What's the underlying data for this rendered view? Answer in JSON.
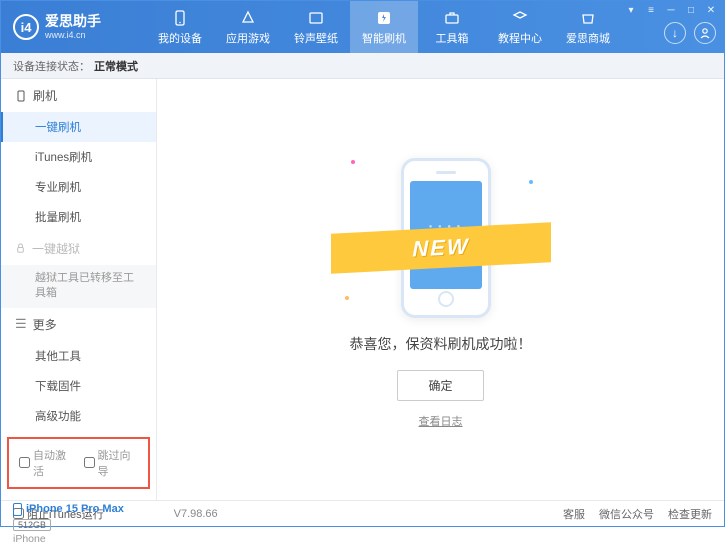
{
  "header": {
    "logo_title": "爱思助手",
    "logo_url": "www.i4.cn",
    "nav": [
      {
        "label": "我的设备"
      },
      {
        "label": "应用游戏"
      },
      {
        "label": "铃声壁纸"
      },
      {
        "label": "智能刷机"
      },
      {
        "label": "工具箱"
      },
      {
        "label": "教程中心"
      },
      {
        "label": "爱思商城"
      }
    ],
    "active_nav_index": 3
  },
  "status": {
    "label": "设备连接状态：",
    "value": "正常模式"
  },
  "sidebar": {
    "section_flash": "刷机",
    "items_flash": [
      "一键刷机",
      "iTunes刷机",
      "专业刷机",
      "批量刷机"
    ],
    "active_flash_index": 0,
    "section_jailbreak": "一键越狱",
    "jailbreak_note": "越狱工具已转移至工具箱",
    "section_more": "更多",
    "items_more": [
      "其他工具",
      "下载固件",
      "高级功能"
    ],
    "checks": {
      "auto_activate": "自动激活",
      "skip_guide": "跳过向导"
    },
    "device": {
      "name": "iPhone 15 Pro Max",
      "storage": "512GB",
      "type": "iPhone"
    }
  },
  "main": {
    "banner": "NEW",
    "message": "恭喜您，保资料刷机成功啦！",
    "ok": "确定",
    "view_log": "查看日志"
  },
  "footer": {
    "block_itunes": "阻止iTunes运行",
    "version": "V7.98.66",
    "links": [
      "客服",
      "微信公众号",
      "检查更新"
    ]
  }
}
